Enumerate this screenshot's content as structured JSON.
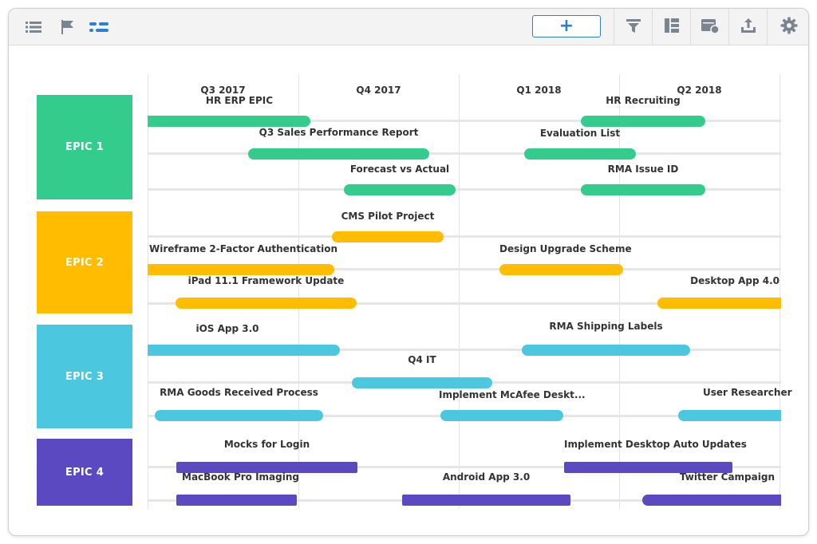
{
  "toolbar": {
    "left_icons": [
      "list-icon",
      "flag-icon",
      "timeline-icon"
    ],
    "add_label": "+",
    "right_icons": [
      "filter-icon",
      "layout-icon",
      "card-settings-icon",
      "export-icon",
      "gear-icon"
    ]
  },
  "timeline": {
    "quarters": [
      "Q3 2017",
      "Q4 2017",
      "Q1 2018",
      "Q2 2018"
    ]
  },
  "colors": {
    "epic1": "#33cc8d",
    "epic2": "#ffbc00",
    "epic3": "#4bc8e0",
    "epic4": "#5a49c0",
    "accent": "#2b7fd4"
  },
  "epics": [
    {
      "label": "EPIC 1",
      "rows": [
        [
          {
            "name": "HR ERP EPIC"
          },
          {
            "name": "HR Recruiting"
          }
        ],
        [
          {
            "name": "Q3 Sales Performance Report"
          },
          {
            "name": "Evaluation List"
          }
        ],
        [
          {
            "name": "Forecast vs Actual"
          },
          {
            "name": "RMA Issue ID"
          }
        ]
      ]
    },
    {
      "label": "EPIC 2",
      "rows": [
        [
          {
            "name": "CMS Pilot Project"
          }
        ],
        [
          {
            "name": "Wireframe 2-Factor Authentication"
          },
          {
            "name": "Design Upgrade Scheme"
          }
        ],
        [
          {
            "name": "iPad 11.1 Framework Update"
          },
          {
            "name": "Desktop App 4.0"
          }
        ]
      ]
    },
    {
      "label": "EPIC 3",
      "rows": [
        [
          {
            "name": "iOS App 3.0"
          },
          {
            "name": "RMA Shipping Labels"
          }
        ],
        [
          {
            "name": "Q4 IT"
          }
        ],
        [
          {
            "name": "RMA Goods Received Process"
          },
          {
            "name": "Implement McAfee Deskt..."
          },
          {
            "name": "User Researcher"
          }
        ]
      ]
    },
    {
      "label": "EPIC 4",
      "rows": [
        [
          {
            "name": "Mocks for Login"
          },
          {
            "name": "Implement Desktop Auto Updates"
          }
        ],
        [
          {
            "name": "MacBook Pro Imaging"
          },
          {
            "name": "Android App 3.0"
          },
          {
            "name": "Twitter Campaign"
          }
        ]
      ]
    }
  ]
}
